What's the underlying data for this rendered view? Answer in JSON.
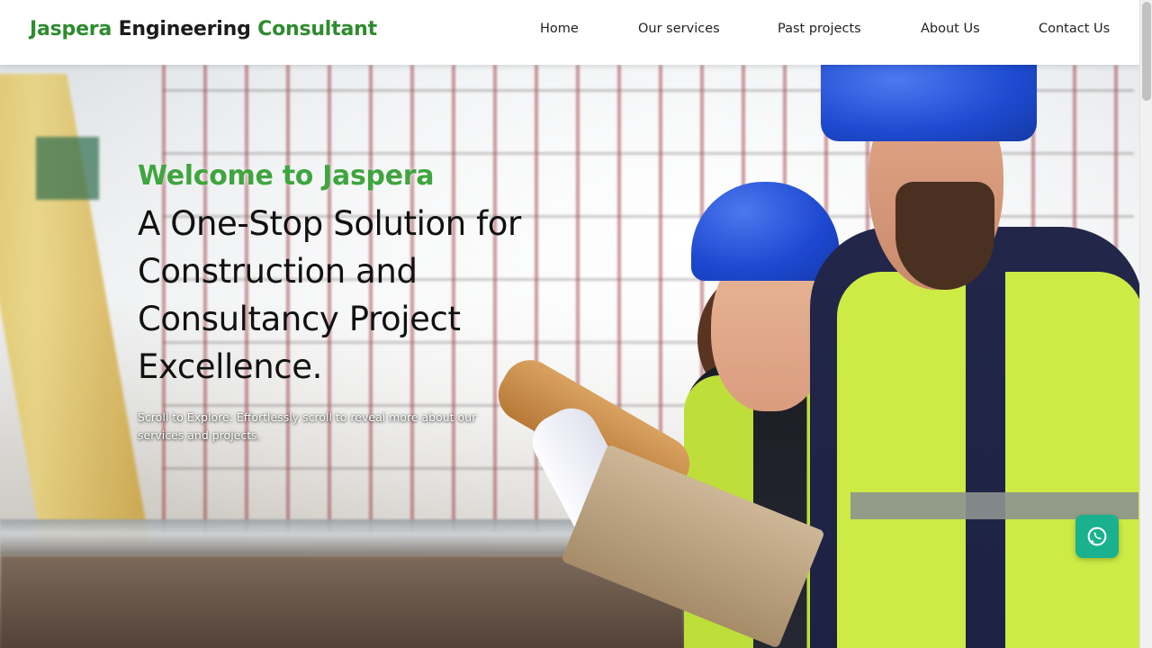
{
  "brand": {
    "part1": "Jaspera",
    "part2": "Engineering",
    "part3": "Consultant"
  },
  "nav": {
    "home": "Home",
    "services": "Our services",
    "projects": "Past projects",
    "about": "About Us",
    "contact": "Contact Us"
  },
  "hero": {
    "welcome": "Welcome to Jaspera",
    "headline": "A One-Stop Solution for Construction and Consultancy Project Excellence.",
    "tagline": "Scroll to Explore: Effortlessly scroll to reveal more about our services and projects."
  },
  "floating": {
    "whatsapp_icon": "whatsapp-icon"
  },
  "colors": {
    "brand_green": "#2e8b2e",
    "welcome_green": "#3fa53f",
    "whatsapp_green": "#1ab28e"
  }
}
